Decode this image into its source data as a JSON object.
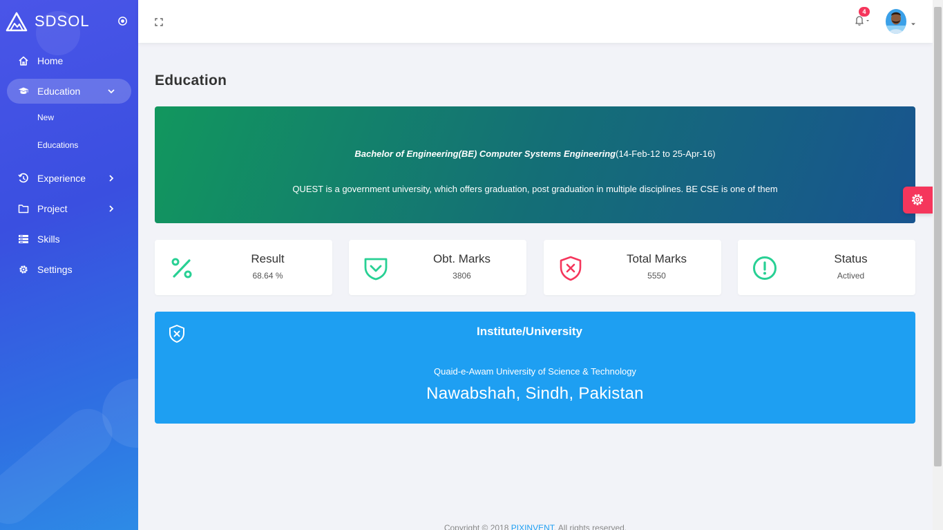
{
  "sidebar": {
    "brand": "SDSOL",
    "items": [
      {
        "label": "Home",
        "icon": "home-icon"
      },
      {
        "label": "Education",
        "icon": "graduation-cap-icon",
        "active": true,
        "expanded": true,
        "children": [
          {
            "label": "New"
          },
          {
            "label": "Educations"
          }
        ]
      },
      {
        "label": "Experience",
        "icon": "history-icon"
      },
      {
        "label": "Project",
        "icon": "folder-icon"
      },
      {
        "label": "Skills",
        "icon": "list-icon"
      },
      {
        "label": "Settings",
        "icon": "gear-icon"
      }
    ]
  },
  "header": {
    "notification_count": "4"
  },
  "page": {
    "title": "Education"
  },
  "hero": {
    "degree": "Bachelor of Engineering(BE) Computer Systems Engineering",
    "dates": "(14-Feb-12 to 25-Apr-16)",
    "description": "QUEST is a government university, which offers graduation, post graduation in multiple disciplines. BE CSE is one of them"
  },
  "cards": [
    {
      "title": "Result",
      "value": "68.64 %",
      "icon": "percent-icon",
      "color": "#28d094"
    },
    {
      "title": "Obt. Marks",
      "value": "3806",
      "icon": "check-shield-icon",
      "color": "#28d094"
    },
    {
      "title": "Total Marks",
      "value": "5550",
      "icon": "x-shield-icon",
      "color": "#f5365c"
    },
    {
      "title": "Status",
      "value": "Actived",
      "icon": "alert-circle-icon",
      "color": "#28d094"
    }
  ],
  "institute": {
    "heading": "Institute/University",
    "name": "Quaid-e-Awam University of Science & Technology",
    "location": "Nawabshah, Sindh, Pakistan"
  },
  "footer": {
    "prefix": "Copyright © 2018",
    "link": "PIXINVENT",
    "suffix": ", All rights reserved."
  },
  "colors": {
    "accent": "#1e9ff2",
    "danger": "#f5365c",
    "success": "#28d094"
  }
}
